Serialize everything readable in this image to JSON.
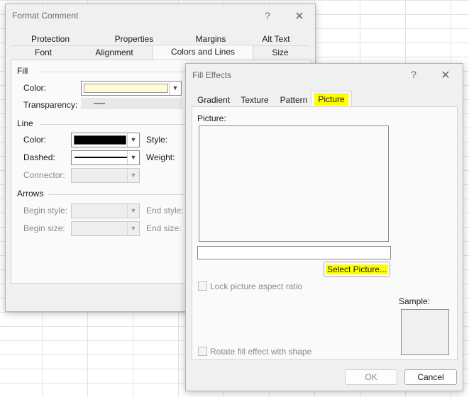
{
  "format_comment": {
    "title": "Format Comment",
    "help": "?",
    "close": "✕",
    "tabs_top": [
      "Protection",
      "Properties",
      "Margins",
      "Alt Text"
    ],
    "tabs_bottom": [
      "Font",
      "Alignment",
      "Colors and Lines",
      "Size"
    ],
    "active_tab": "Colors and Lines",
    "fill": {
      "section": "Fill",
      "color_label": "Color:",
      "color_value": "#fffcd6",
      "transparency_label": "Transparency:"
    },
    "line": {
      "section": "Line",
      "color_label": "Color:",
      "color_value": "#000000",
      "dashed_label": "Dashed:",
      "connector_label": "Connector:",
      "style_label": "Style:",
      "weight_label": "Weight:"
    },
    "arrows": {
      "section": "Arrows",
      "begin_style_label": "Begin style:",
      "begin_size_label": "Begin size:",
      "end_style_label": "End style:",
      "end_size_label": "End size:"
    }
  },
  "fill_effects": {
    "title": "Fill Effects",
    "help": "?",
    "close": "✕",
    "tabs": [
      "Gradient",
      "Texture",
      "Pattern",
      "Picture"
    ],
    "active_tab": "Picture",
    "picture_label": "Picture:",
    "select_picture_button": "Select Picture...",
    "lock_aspect_label": "Lock picture aspect ratio",
    "rotate_label": "Rotate fill effect with shape",
    "sample_label": "Sample:",
    "ok_button": "OK",
    "cancel_button": "Cancel",
    "highlight_color": "#ffff00"
  }
}
